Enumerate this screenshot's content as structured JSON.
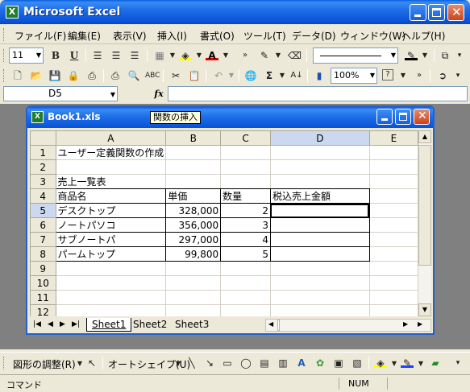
{
  "app": {
    "title": "Microsoft Excel",
    "logo_letter": "X"
  },
  "menu": [
    "ファイル(F)",
    "編集(E)",
    "表示(V)",
    "挿入(I)",
    "書式(O)",
    "ツール(T)",
    "データ(D)",
    "ウィンドウ(W)",
    "ヘルプ(H)"
  ],
  "format_toolbar": {
    "font_size": "11",
    "bold": "B",
    "underline": "U"
  },
  "standard_toolbar": {
    "zoom": "100%",
    "sum": "Σ"
  },
  "formula_bar": {
    "name_box": "D5",
    "fx": "fx",
    "content": ""
  },
  "workbook": {
    "title": "Book1.xls",
    "logo_letter": "X",
    "tooltip": "関数の挿入",
    "columns": [
      "A",
      "B",
      "C",
      "D",
      "E"
    ],
    "rows": [
      {
        "n": "1",
        "cells": [
          "ユーザー定義関数の作成",
          "",
          "",
          "",
          ""
        ]
      },
      {
        "n": "2",
        "cells": [
          "",
          "",
          "",
          "",
          ""
        ]
      },
      {
        "n": "3",
        "cells": [
          "売上一覧表",
          "",
          "",
          "",
          ""
        ]
      },
      {
        "n": "4",
        "cells": [
          "商品名",
          "単価",
          "数量",
          "税込売上金額",
          ""
        ]
      },
      {
        "n": "5",
        "cells": [
          "デスクトップ",
          "328,000",
          "2",
          "",
          ""
        ]
      },
      {
        "n": "6",
        "cells": [
          "ノートパソコ",
          "356,000",
          "3",
          "",
          ""
        ]
      },
      {
        "n": "7",
        "cells": [
          "サブノートパ",
          "297,000",
          "4",
          "",
          ""
        ]
      },
      {
        "n": "8",
        "cells": [
          "パームトップ",
          "99,800",
          "5",
          "",
          ""
        ]
      },
      {
        "n": "9",
        "cells": [
          "",
          "",
          "",
          "",
          ""
        ]
      },
      {
        "n": "10",
        "cells": [
          "",
          "",
          "",
          "",
          ""
        ]
      },
      {
        "n": "11",
        "cells": [
          "",
          "",
          "",
          "",
          ""
        ]
      },
      {
        "n": "12",
        "cells": [
          "",
          "",
          "",
          "",
          ""
        ]
      }
    ],
    "tabs": [
      "Sheet1",
      "Sheet2",
      "Sheet3"
    ],
    "active_tab": "Sheet1"
  },
  "draw_toolbar": {
    "adjust": "図形の調整(R)",
    "autoshape": "オートシェイプ(U)"
  },
  "status": {
    "left": "コマンド",
    "num": "NUM"
  }
}
